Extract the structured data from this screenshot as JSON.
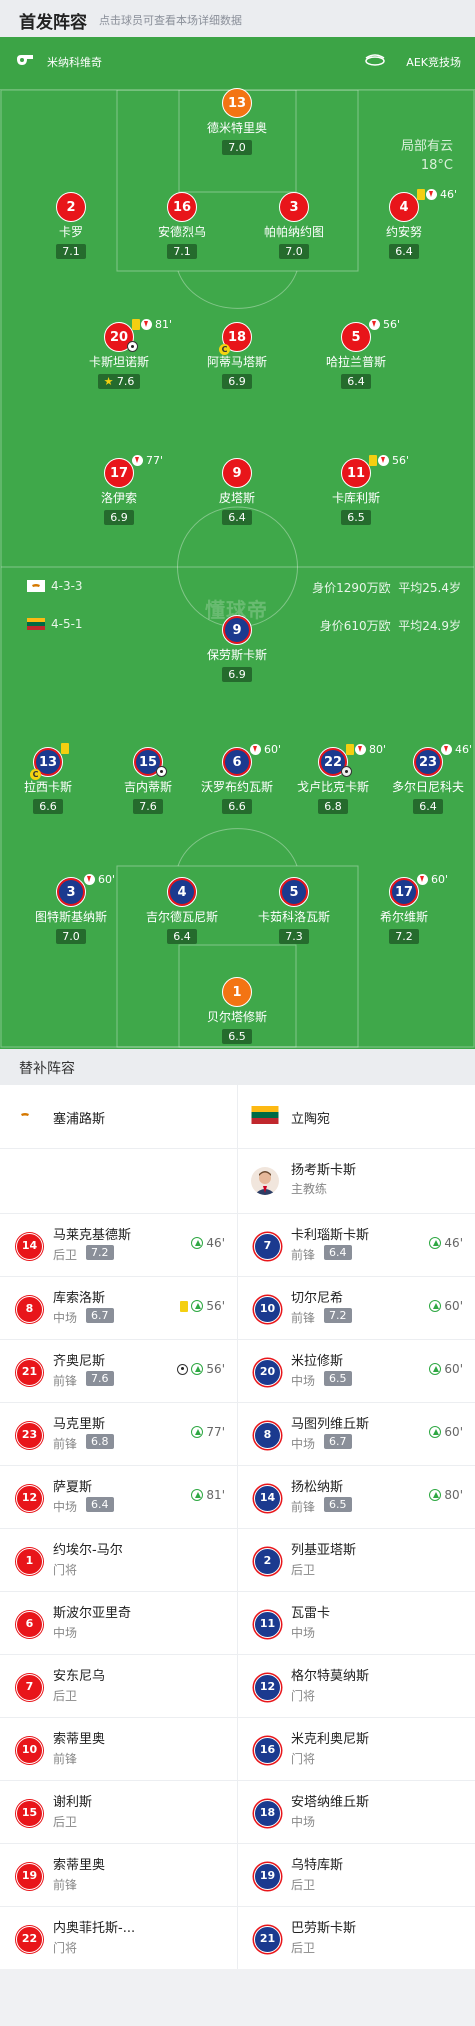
{
  "header": {
    "title": "首发阵容",
    "subtitle": "点击球员可查看本场详细数据"
  },
  "infobar": {
    "referee": "米纳科维奇",
    "venue": "AEK竞技场"
  },
  "weather": {
    "line1": "局部有云",
    "line2": "18°C"
  },
  "colors": {
    "home": "#e8151a",
    "away": "#1b3a8f",
    "gk": "#f37413",
    "pitch": "#3fa84a"
  },
  "home": {
    "formation": "4-3-3",
    "value": "身价1290万欧",
    "age": "平均25.4岁",
    "players": [
      {
        "num": "13",
        "name": "德米特里奥",
        "rating": "7.0",
        "color": "orange"
      },
      {
        "num": "2",
        "name": "卡罗",
        "rating": "7.1",
        "color": "red"
      },
      {
        "num": "16",
        "name": "安德烈乌",
        "rating": "7.1",
        "color": "red"
      },
      {
        "num": "3",
        "name": "帕帕纳约图",
        "rating": "7.0",
        "color": "red"
      },
      {
        "num": "4",
        "name": "约安努",
        "rating": "6.4",
        "color": "red",
        "yellow": true,
        "subout": true,
        "min": "46'"
      },
      {
        "num": "20",
        "name": "卡斯坦诺斯",
        "rating": "7.6",
        "color": "red",
        "yellow": true,
        "subout": true,
        "min": "81'",
        "goal": true,
        "star": true
      },
      {
        "num": "18",
        "name": "阿蒂马塔斯",
        "rating": "6.9",
        "color": "red",
        "captain": true
      },
      {
        "num": "5",
        "name": "哈拉兰普斯",
        "rating": "6.4",
        "color": "red",
        "subout": true,
        "min": "56'"
      },
      {
        "num": "17",
        "name": "洛伊索",
        "rating": "6.9",
        "color": "red",
        "subout": true,
        "min": "77'"
      },
      {
        "num": "9",
        "name": "皮塔斯",
        "rating": "6.4",
        "color": "red"
      },
      {
        "num": "11",
        "name": "卡库利斯",
        "rating": "6.5",
        "color": "red",
        "yellow": true,
        "subout": true,
        "min": "56'"
      }
    ]
  },
  "away": {
    "formation": "4-5-1",
    "value": "身价610万欧",
    "age": "平均24.9岁",
    "players": [
      {
        "num": "9",
        "name": "保劳斯卡斯",
        "rating": "6.9",
        "color": "blue"
      },
      {
        "num": "13",
        "name": "拉西卡斯",
        "rating": "6.6",
        "color": "blue",
        "yellow": true,
        "captain": true
      },
      {
        "num": "15",
        "name": "吉内蒂斯",
        "rating": "7.6",
        "color": "blue",
        "goal": true
      },
      {
        "num": "6",
        "name": "沃罗布约瓦斯",
        "rating": "6.6",
        "color": "blue",
        "subout": true,
        "min": "60'"
      },
      {
        "num": "22",
        "name": "戈卢比克卡斯",
        "rating": "6.8",
        "color": "blue",
        "yellow": true,
        "subout": true,
        "min": "80'",
        "subinmark": true
      },
      {
        "num": "23",
        "name": "多尔日尼科夫",
        "rating": "6.4",
        "color": "blue",
        "subout": true,
        "min": "46'"
      },
      {
        "num": "3",
        "name": "图特斯基纳斯",
        "rating": "7.0",
        "color": "blue",
        "subout": true,
        "min": "60'"
      },
      {
        "num": "4",
        "name": "吉尔德瓦尼斯",
        "rating": "6.4",
        "color": "blue"
      },
      {
        "num": "5",
        "name": "卡茹科洛瓦斯",
        "rating": "7.3",
        "color": "blue"
      },
      {
        "num": "17",
        "name": "希尔维斯",
        "rating": "7.2",
        "color": "blue",
        "subout": true,
        "min": "60'"
      },
      {
        "num": "1",
        "name": "贝尔塔修斯",
        "rating": "6.5",
        "color": "orange"
      }
    ]
  },
  "subs": {
    "title": "替补阵容",
    "home_team": "塞浦路斯",
    "away_team": "立陶宛",
    "away_coach": {
      "name": "扬考斯卡斯",
      "role": "主教练"
    },
    "rows": [
      [
        {
          "num": "14",
          "name": "马莱克基德斯",
          "pos": "后卫",
          "rating": "7.2",
          "min": "46'"
        },
        {
          "num": "7",
          "name": "卡利瑙斯卡斯",
          "pos": "前锋",
          "rating": "6.4",
          "min": "46'"
        }
      ],
      [
        {
          "num": "8",
          "name": "库索洛斯",
          "pos": "中场",
          "rating": "6.7",
          "min": "56'",
          "yellow": true
        },
        {
          "num": "10",
          "name": "切尔尼希",
          "pos": "前锋",
          "rating": "7.2",
          "min": "60'"
        }
      ],
      [
        {
          "num": "21",
          "name": "齐奥尼斯",
          "pos": "前锋",
          "rating": "7.6",
          "min": "56'",
          "goal": true
        },
        {
          "num": "20",
          "name": "米拉修斯",
          "pos": "中场",
          "rating": "6.5",
          "min": "60'"
        }
      ],
      [
        {
          "num": "23",
          "name": "马克里斯",
          "pos": "前锋",
          "rating": "6.8",
          "min": "77'"
        },
        {
          "num": "8",
          "name": "马图列维丘斯",
          "pos": "中场",
          "rating": "6.7",
          "min": "60'"
        }
      ],
      [
        {
          "num": "12",
          "name": "萨夏斯",
          "pos": "中场",
          "rating": "6.4",
          "min": "81'"
        },
        {
          "num": "14",
          "name": "扬松纳斯",
          "pos": "前锋",
          "rating": "6.5",
          "min": "80'"
        }
      ],
      [
        {
          "num": "1",
          "name": "约埃尔-马尔",
          "pos": "门将"
        },
        {
          "num": "2",
          "name": "列基亚塔斯",
          "pos": "后卫"
        }
      ],
      [
        {
          "num": "6",
          "name": "斯波尔亚里奇",
          "pos": "中场"
        },
        {
          "num": "11",
          "name": "瓦雷卡",
          "pos": "中场"
        }
      ],
      [
        {
          "num": "7",
          "name": "安东尼乌",
          "pos": "后卫"
        },
        {
          "num": "12",
          "name": "格尔特莫纳斯",
          "pos": "门将"
        }
      ],
      [
        {
          "num": "10",
          "name": "索蒂里奥",
          "pos": "前锋"
        },
        {
          "num": "16",
          "name": "米克利奥尼斯",
          "pos": "门将"
        }
      ],
      [
        {
          "num": "15",
          "name": "谢利斯",
          "pos": "后卫"
        },
        {
          "num": "18",
          "name": "安塔纳维丘斯",
          "pos": "中场"
        }
      ],
      [
        {
          "num": "19",
          "name": "索蒂里奥",
          "pos": "前锋"
        },
        {
          "num": "19",
          "name": "乌特库斯",
          "pos": "后卫"
        }
      ],
      [
        {
          "num": "22",
          "name": "内奥菲托斯-...",
          "pos": "门将"
        },
        {
          "num": "21",
          "name": "巴劳斯卡斯",
          "pos": "后卫"
        }
      ]
    ]
  }
}
